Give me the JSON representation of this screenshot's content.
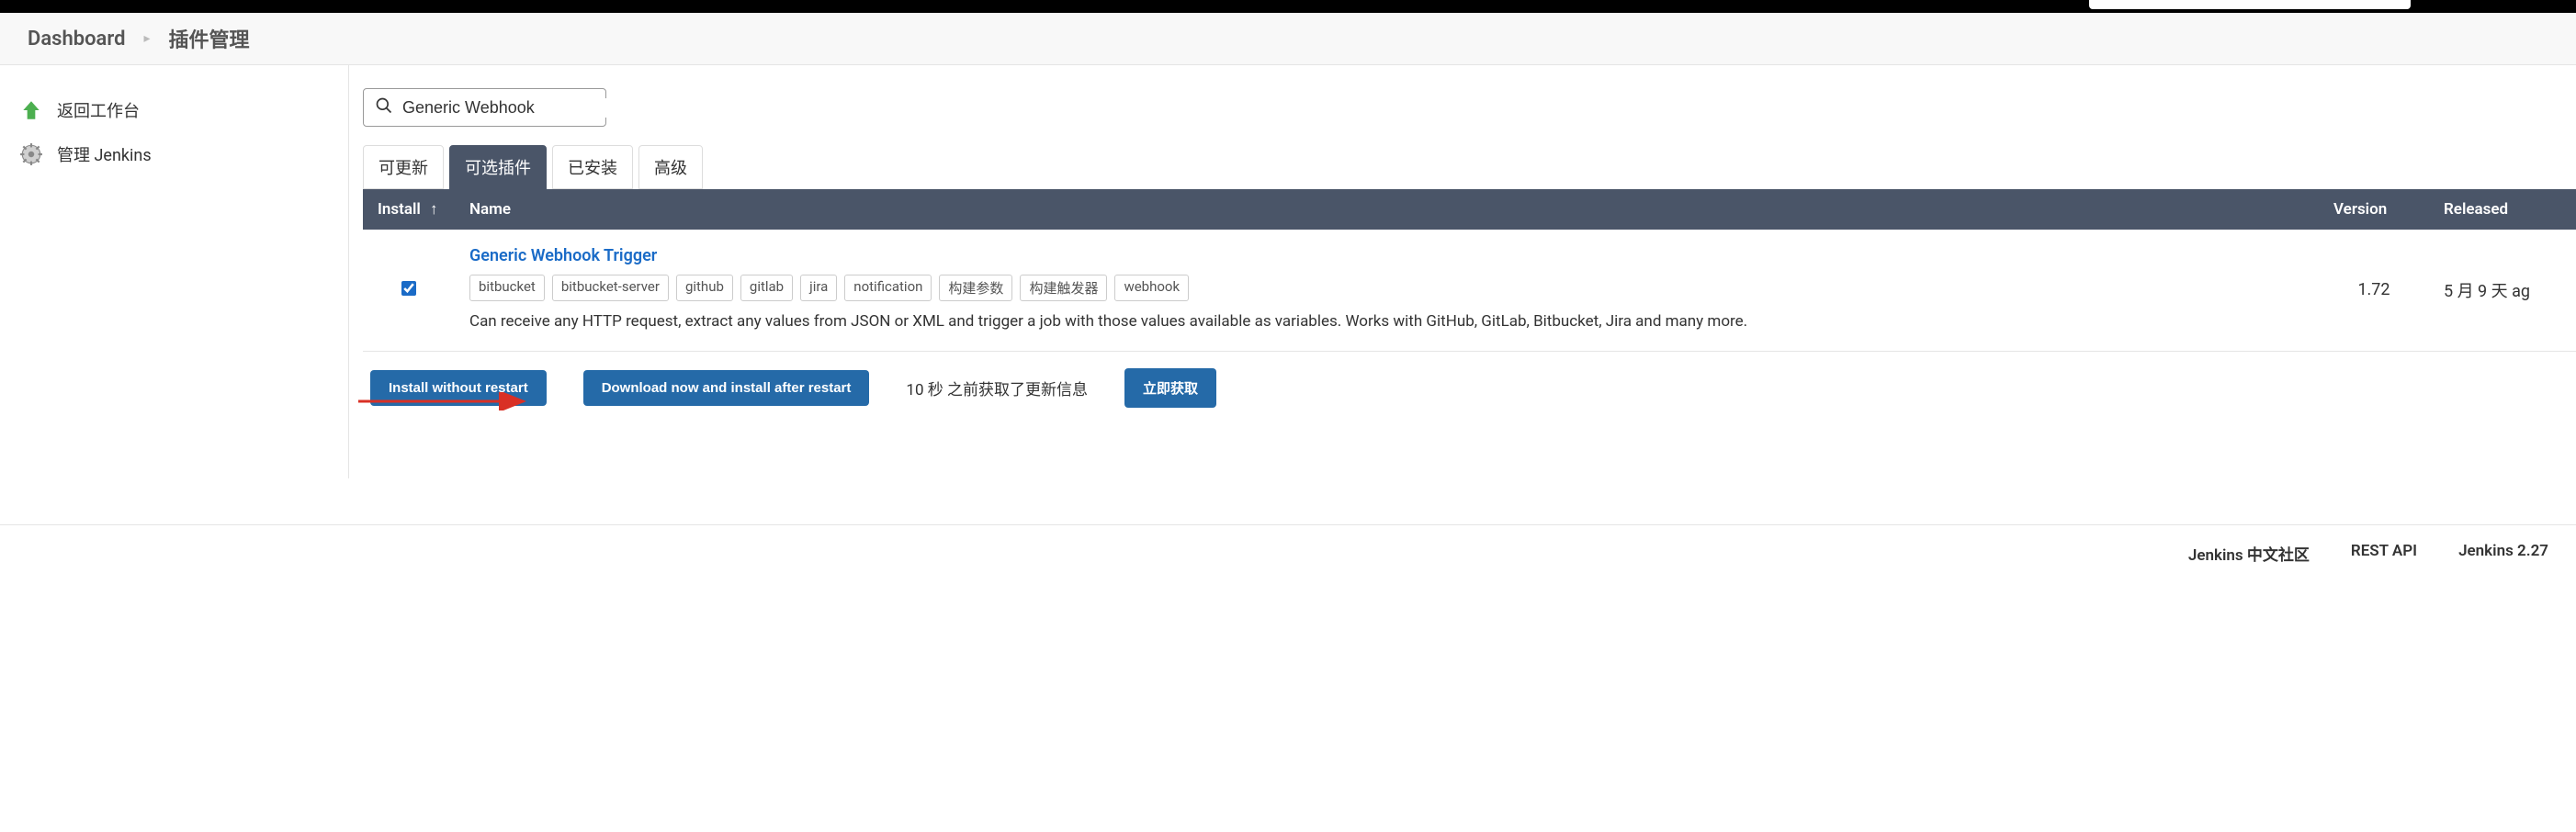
{
  "breadcrumb": {
    "dashboard": "Dashboard",
    "current": "插件管理"
  },
  "sidebar": {
    "items": [
      {
        "label": "返回工作台",
        "icon": "up-arrow-icon"
      },
      {
        "label": "管理 Jenkins",
        "icon": "gear-icon"
      }
    ]
  },
  "search": {
    "value": "Generic Webhook"
  },
  "tabs": [
    {
      "label": "可更新",
      "active": false
    },
    {
      "label": "可选插件",
      "active": true
    },
    {
      "label": "已安装",
      "active": false
    },
    {
      "label": "高级",
      "active": false
    }
  ],
  "table": {
    "headers": {
      "install": "Install",
      "name": "Name",
      "version": "Version",
      "released": "Released"
    },
    "sort_indicator": "↑",
    "rows": [
      {
        "checked": true,
        "name": "Generic Webhook Trigger",
        "tags": [
          "bitbucket",
          "bitbucket-server",
          "github",
          "gitlab",
          "jira",
          "notification",
          "构建参数",
          "构建触发器",
          "webhook"
        ],
        "description": "Can receive any HTTP request, extract any values from JSON or XML and trigger a job with those values available as variables. Works with GitHub, GitLab, Bitbucket, Jira and many more.",
        "version": "1.72",
        "released": "5 月 9 天 ag"
      }
    ]
  },
  "actions": {
    "install_without_restart": "Install without restart",
    "download_install_restart": "Download now and install after restart",
    "update_status": "10 秒 之前获取了更新信息",
    "fetch_now": "立即获取"
  },
  "footer": {
    "community": "Jenkins 中文社区",
    "rest_api": "REST API",
    "version": "Jenkins 2.27"
  }
}
